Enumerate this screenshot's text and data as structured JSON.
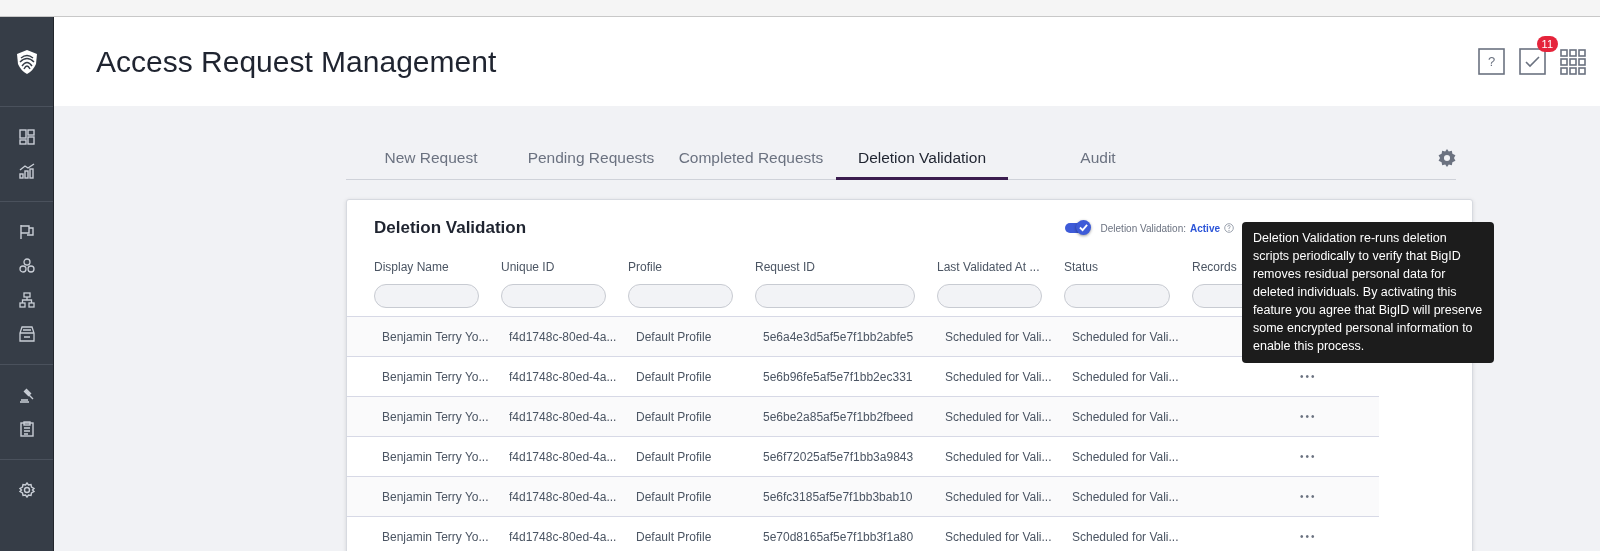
{
  "header": {
    "title": "Access Request Management",
    "tasks_badge": "11",
    "help_label": "?"
  },
  "tabs": [
    {
      "label": "New Request",
      "selected": false
    },
    {
      "label": "Pending Requests",
      "selected": false
    },
    {
      "label": "Completed Requests",
      "selected": false
    },
    {
      "label": "Deletion Validation",
      "selected": true
    },
    {
      "label": "Audit",
      "selected": false
    }
  ],
  "card": {
    "title": "Deletion Validation",
    "toggle": {
      "on": true,
      "label": "Deletion Validation:",
      "status": "Active"
    },
    "tooltip": "Deletion Validation re-runs deletion scripts periodically to verify that BigID removes residual personal data for deleted individuals. By activating this feature you agree that BigID will preserve some encrypted personal information to enable this process.",
    "columns": [
      "Display Name",
      "Unique ID",
      "Profile",
      "Request ID",
      "Last Validated At ...",
      "Status",
      "Records"
    ],
    "rows": [
      {
        "cells": [
          "Benjamin Terry Yo...",
          "f4d1748c-80ed-4a...",
          "Default Profile",
          "5e6a4e3d5af5e7f1bb2abfe5",
          "Scheduled for Vali...",
          "Scheduled for Vali..."
        ]
      },
      {
        "cells": [
          "Benjamin Terry Yo...",
          "f4d1748c-80ed-4a...",
          "Default Profile",
          "5e6b96fe5af5e7f1bb2ec331",
          "Scheduled for Vali...",
          "Scheduled for Vali..."
        ],
        "actions": "•••"
      },
      {
        "cells": [
          "Benjamin Terry Yo...",
          "f4d1748c-80ed-4a...",
          "Default Profile",
          "5e6be2a85af5e7f1bb2fbeed",
          "Scheduled for Vali...",
          "Scheduled for Vali..."
        ],
        "actions": "•••"
      },
      {
        "cells": [
          "Benjamin Terry Yo...",
          "f4d1748c-80ed-4a...",
          "Default Profile",
          "5e6f72025af5e7f1bb3a9843",
          "Scheduled for Vali...",
          "Scheduled for Vali..."
        ],
        "actions": "•••"
      },
      {
        "cells": [
          "Benjamin Terry Yo...",
          "f4d1748c-80ed-4a...",
          "Default Profile",
          "5e6fc3185af5e7f1bb3bab10",
          "Scheduled for Vali...",
          "Scheduled for Vali..."
        ],
        "actions": "•••"
      },
      {
        "cells": [
          "Benjamin Terry Yo...",
          "f4d1748c-80ed-4a...",
          "Default Profile",
          "5e70d8165af5e7f1bb3f1a80",
          "Scheduled for Vali...",
          "Scheduled for Vali..."
        ],
        "actions": "•••"
      }
    ]
  }
}
